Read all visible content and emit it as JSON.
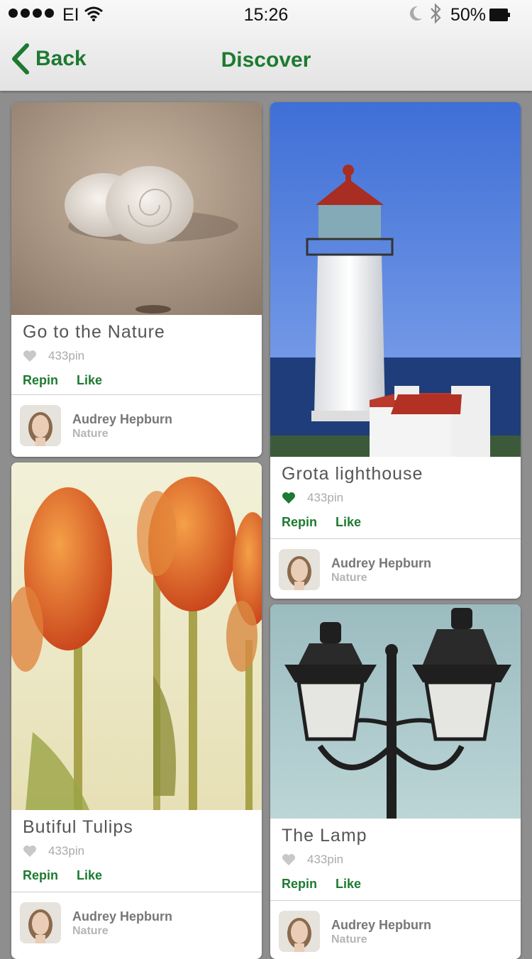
{
  "status_bar": {
    "carrier": "EI",
    "time": "15:26",
    "battery": "50%"
  },
  "nav": {
    "back_label": "Back",
    "title": "Discover"
  },
  "colors": {
    "accent": "#1d7a30",
    "heart_liked": "#1d7a30",
    "heart_default": "#c8c8c8"
  },
  "cards": [
    {
      "title": "Go to the Nature",
      "pins": "433pin",
      "liked": false,
      "repin_label": "Repin",
      "like_label": "Like",
      "author": "Audrey Hepburn",
      "category": "Nature",
      "image": "seashell-on-sand"
    },
    {
      "title": "Grota lighthouse",
      "pins": "433pin",
      "liked": true,
      "repin_label": "Repin",
      "like_label": "Like",
      "author": "Audrey Hepburn",
      "category": "Nature",
      "image": "lighthouse"
    },
    {
      "title": "Butiful Tulips",
      "pins": "433pin",
      "liked": false,
      "repin_label": "Repin",
      "like_label": "Like",
      "author": "Audrey Hepburn",
      "category": "Nature",
      "image": "tulips"
    },
    {
      "title": "The Lamp",
      "pins": "433pin",
      "liked": false,
      "repin_label": "Repin",
      "like_label": "Like",
      "author": "Audrey Hepburn",
      "category": "Nature",
      "image": "street-lamp"
    }
  ]
}
